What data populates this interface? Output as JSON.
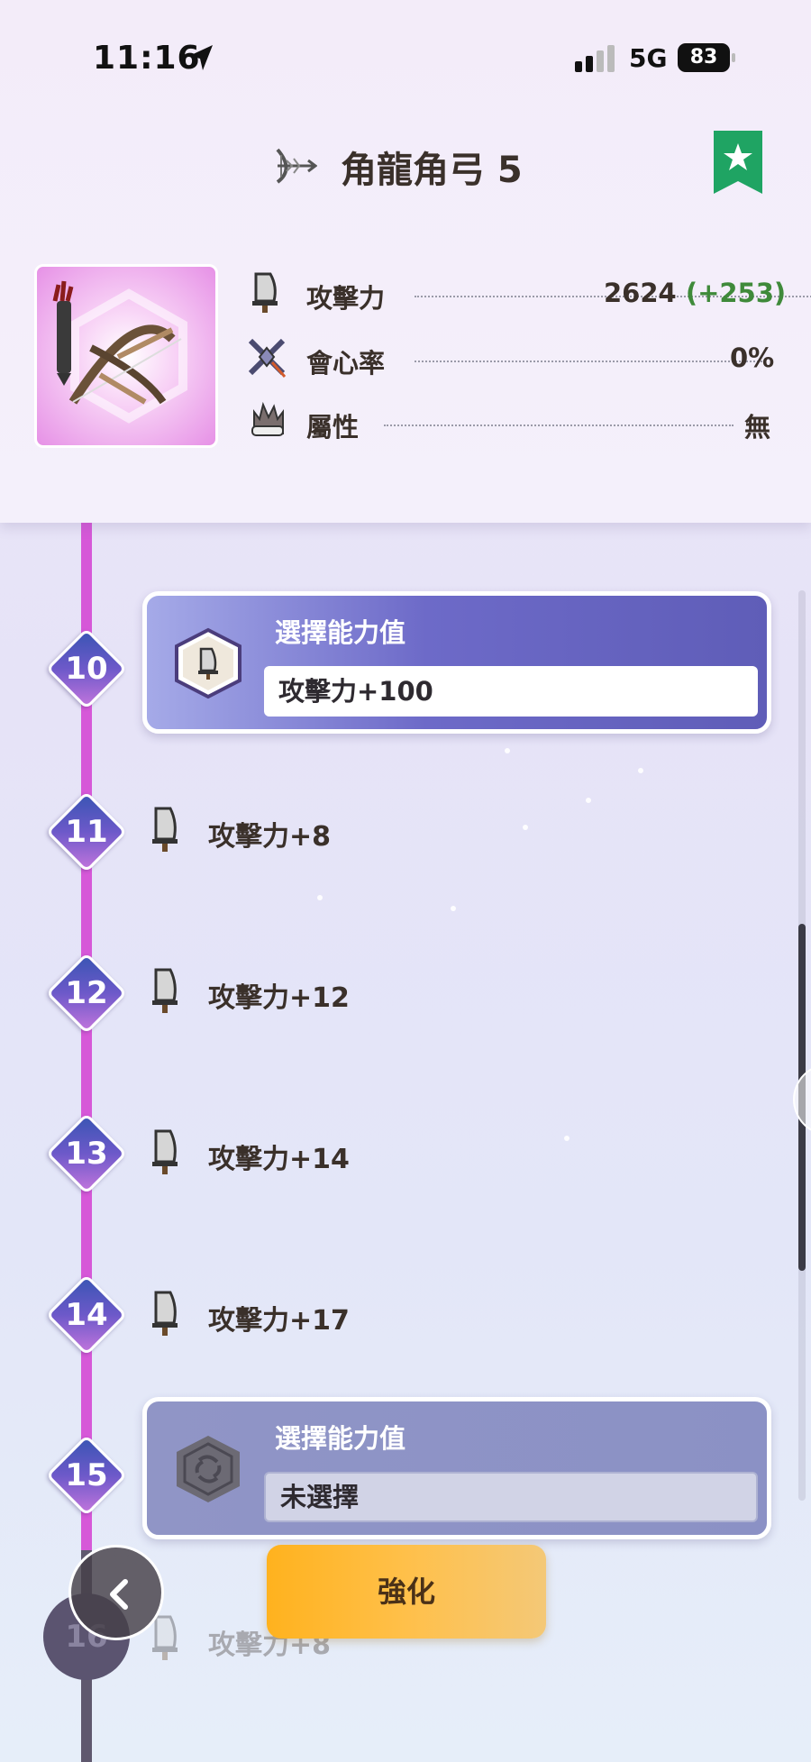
{
  "status_bar": {
    "time": "11:16",
    "network": "5G",
    "battery": "83"
  },
  "header": {
    "title": "角龍角弓 5",
    "icon": "bow-icon",
    "bookmark_icon": "star-bookmark-icon",
    "accent_color": "#1fa463"
  },
  "stats": [
    {
      "icon": "attack-icon",
      "label": "攻擊力",
      "value": "2624",
      "bonus": "(+253)"
    },
    {
      "icon": "affinity-icon",
      "label": "會心率",
      "value": "0%"
    },
    {
      "icon": "element-icon",
      "label": "屬性",
      "value": "無"
    }
  ],
  "timeline": {
    "levels": [
      {
        "num": "10",
        "kind": "choice",
        "title": "選擇能力值",
        "value": "攻擊力+100"
      },
      {
        "num": "11",
        "kind": "reward",
        "label": "攻擊力+8"
      },
      {
        "num": "12",
        "kind": "reward",
        "label": "攻擊力+12"
      },
      {
        "num": "13",
        "kind": "reward",
        "label": "攻擊力+14"
      },
      {
        "num": "14",
        "kind": "reward",
        "label": "攻擊力+17"
      },
      {
        "num": "15",
        "kind": "choice",
        "title": "選擇能力值",
        "value": "未選擇"
      },
      {
        "num": "16",
        "kind": "reward",
        "label": "攻擊力+8",
        "locked": true
      }
    ]
  },
  "controls": {
    "back_icon": "chevron-left-icon",
    "enhance_label": "強化"
  }
}
